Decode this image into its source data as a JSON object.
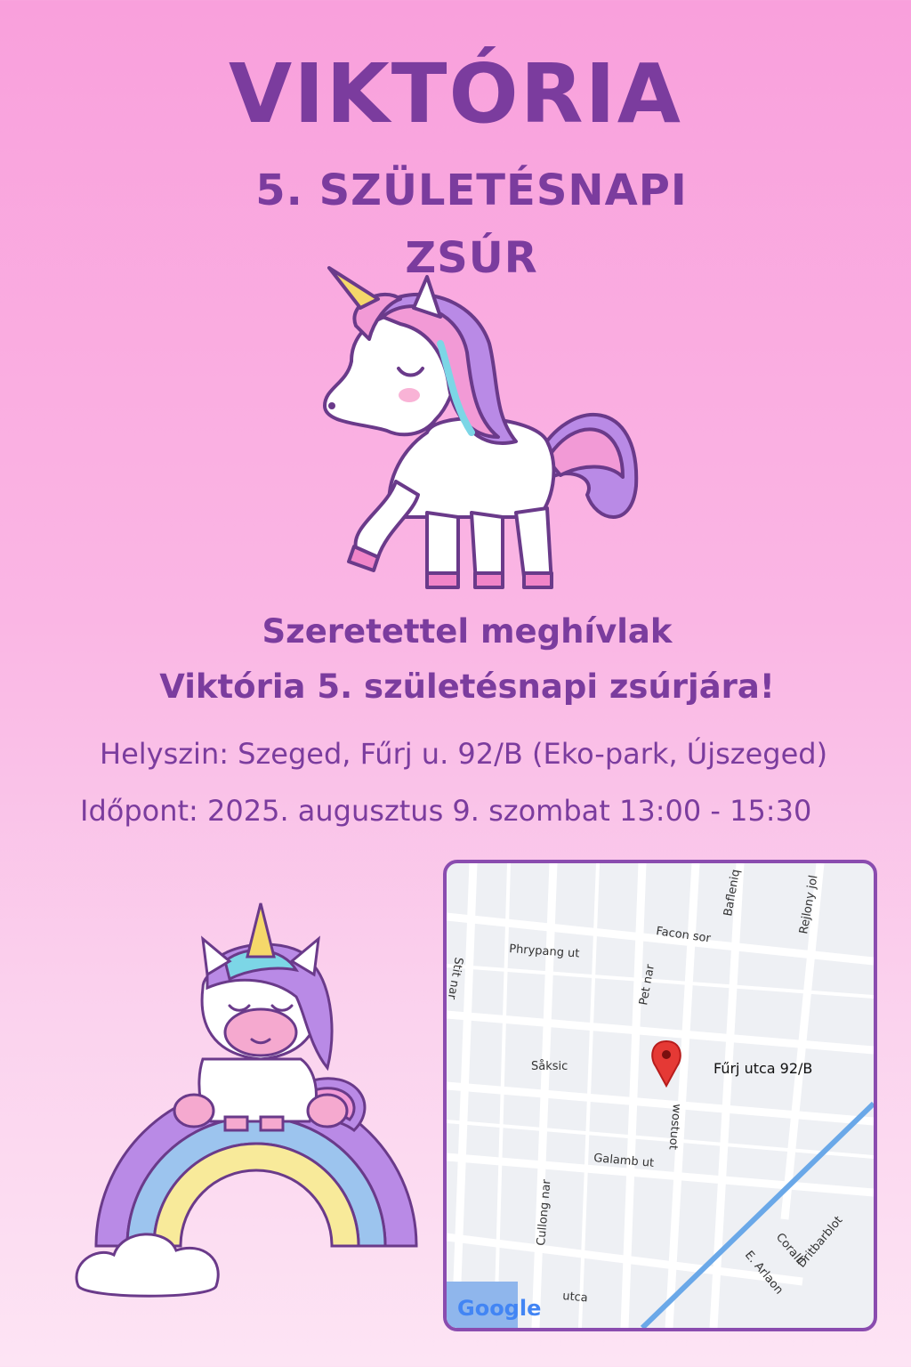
{
  "title": "VIKTÓRIA",
  "subtitle": {
    "line1": "5. SZÜLETÉSNAPI",
    "line2": "ZSÚR"
  },
  "invitation": {
    "line1": "Szeretettel meghívlak",
    "line2": "Viktória 5. születésnapi zsúrjára!"
  },
  "details": {
    "location": "Helyszin: Szeged, Fűrj u. 92/B (Eko-park, Újszeged)",
    "time": "Időpont: 2025. augusztus 9. szombat 13:00 - 15:30"
  },
  "map": {
    "pin_label": "Fűrj utca 92/B",
    "streets": [
      "Facon sor",
      "Phrypang ut",
      "Såksic",
      "Galamb ut",
      "utca",
      "Pet nar",
      "Bafleniq",
      "Rejlony jol",
      "Stit nar",
      "Cullong nar",
      "wostuot",
      "Coralli",
      "E. Arlaon",
      "Dritbarblot"
    ],
    "logo": "Google",
    "colors": {
      "pin": "#e53935",
      "border": "#8a4caf",
      "water": "#6aa8e8"
    }
  },
  "colors": {
    "text": "#7b3c9e",
    "bg_top": "#f9a0dc",
    "bg_bottom": "#fde4f4"
  },
  "icons": [
    "unicorn-standing-illustration",
    "unicorn-on-rainbow-illustration",
    "map-pin-icon"
  ]
}
